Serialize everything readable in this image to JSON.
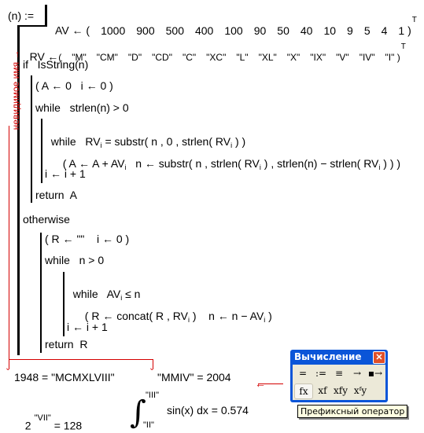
{
  "function_def": {
    "head": "(n) :=",
    "invisible_name_label": "невидимое имя",
    "line_av": {
      "lhs": "AV",
      "assign": "←",
      "values": [
        "1000",
        "900",
        "500",
        "400",
        "100",
        "90",
        "50",
        "40",
        "10",
        "9",
        "5",
        "4",
        "1"
      ],
      "transpose": "T"
    },
    "line_rv": {
      "lhs": "RV",
      "assign": "←",
      "values": [
        "\"M\"",
        "\"CM\"",
        "\"D\"",
        "\"CD\"",
        "\"C\"",
        "\"XC\"",
        "\"L\"",
        "\"XL\"",
        "\"X\"",
        "\"IX\"",
        "\"V\"",
        "\"IV\"",
        "\"I\""
      ],
      "transpose": "T"
    },
    "if_line": "if   IsString(n)",
    "if_block": {
      "init": "( A ← 0   i ← 0 )",
      "while_outer": "while   strlen(n) > 0",
      "while_inner": "while   RV",
      "while_inner_rest": " = substr( n , 0 , strlen( RV",
      "while_inner_end": " ) )",
      "body": "( A ← A + AV",
      "body_mid": "   n ← substr( n , strlen( RV",
      "body_mid2": " ) , strlen(n) − strlen( RV",
      "body_end": " ) ) )",
      "inc": "i ← i + 1",
      "ret": "return  A"
    },
    "otherwise": "otherwise",
    "else_block": {
      "init": "( R ← \"\"    i ← 0 )",
      "while_outer": "while   n > 0",
      "while_inner": "while   AV",
      "while_inner_rest": " ≤ n",
      "body": "( R ← concat( R , RV",
      "body_mid": " )    n ← n − AV",
      "body_end": " )",
      "inc": "i ← i + 1",
      "ret": "return  R"
    },
    "subscript_i": "i"
  },
  "results": {
    "r1": "1948 = \"MCMXLVIII\"",
    "r2": "\"MMIV\" = 2004",
    "r3_base": "2",
    "r3_exp": "\"VII\"",
    "r3_rest": " = 128",
    "r4_upper": "\"III\"",
    "r4_lower": "\"II\"",
    "r4_expr": "sin(x) dx = 0.574",
    "integral_sign": "∫"
  },
  "toolbar": {
    "title": "Вычисление",
    "close": "✕",
    "row1": [
      "=",
      ":=",
      "≡",
      "→",
      "▪→"
    ],
    "row2": [
      "fx",
      "xf",
      "xfy",
      "xᶠy"
    ],
    "tooltip": "Префиксный оператор"
  },
  "colors": {
    "annotation_red": "#d40000",
    "titlebar_blue": "#0a55d8"
  }
}
